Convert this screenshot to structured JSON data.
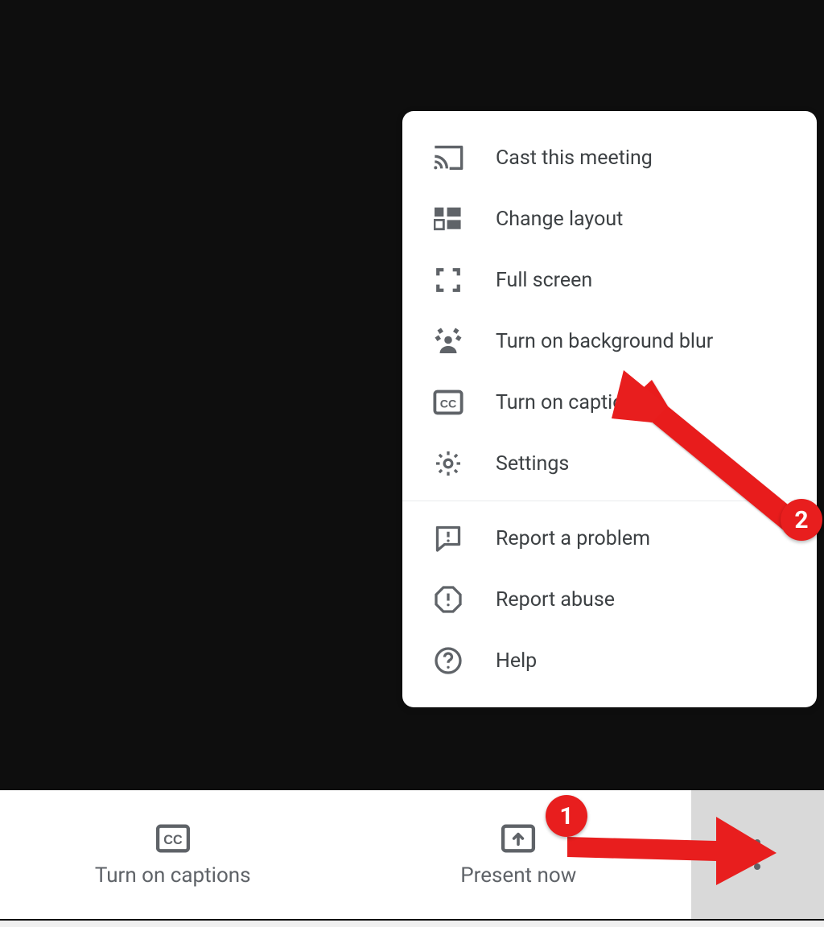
{
  "menu": {
    "items": [
      {
        "name": "cast-this-meeting",
        "icon": "cast-icon",
        "label": "Cast this meeting"
      },
      {
        "name": "change-layout",
        "icon": "layout-icon",
        "label": "Change layout"
      },
      {
        "name": "full-screen",
        "icon": "fullscreen-icon",
        "label": "Full screen"
      },
      {
        "name": "turn-on-background-blur",
        "icon": "blur-icon",
        "label": "Turn on background blur"
      },
      {
        "name": "turn-on-captions",
        "icon": "cc-icon",
        "label": "Turn on captions"
      },
      {
        "name": "settings",
        "icon": "gear-icon",
        "label": "Settings"
      }
    ],
    "lower_items": [
      {
        "name": "report-a-problem",
        "icon": "feedback-icon",
        "label": "Report a problem"
      },
      {
        "name": "report-abuse",
        "icon": "abuse-icon",
        "label": "Report abuse"
      },
      {
        "name": "help",
        "icon": "help-icon",
        "label": "Help"
      }
    ]
  },
  "bottom": {
    "captions_label": "Turn on captions",
    "present_label": "Present now"
  },
  "annotations": {
    "step1": "1",
    "step2": "2"
  }
}
